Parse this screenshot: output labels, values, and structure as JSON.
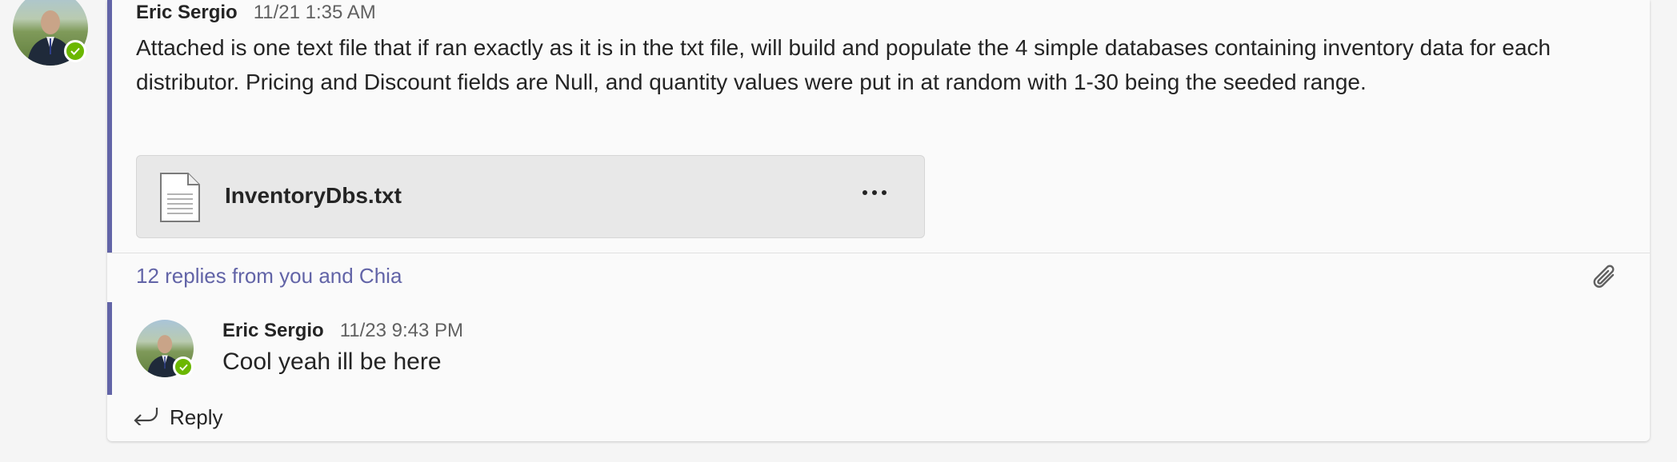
{
  "root_message": {
    "author": "Eric Sergio",
    "timestamp": "11/21 1:35 AM",
    "body": "Attached is one text file that if ran exactly as it is in the txt file, will build  and populate the 4 simple databases containing inventory data for each distributor. Pricing and Discount fields are Null, and quantity values were put in at random with 1-30 being the seeded range.",
    "attachment": {
      "filename": "InventoryDbs.txt",
      "icon": "text-file-icon",
      "more_icon": "more-options-icon"
    },
    "presence": "available"
  },
  "thread": {
    "replies_summary": "12 replies from you and Chia",
    "attachment_icon": "paperclip-icon"
  },
  "reply_message": {
    "author": "Eric Sergio",
    "timestamp": "11/23 9:43 PM",
    "body": "Cool yeah ill be here",
    "presence": "available"
  },
  "reply_action": {
    "label": "Reply",
    "icon": "reply-arrow-icon"
  },
  "colors": {
    "accent": "#6264a7",
    "presence": "#6bb700",
    "background": "#f5f5f5",
    "card": "#fafafa"
  }
}
